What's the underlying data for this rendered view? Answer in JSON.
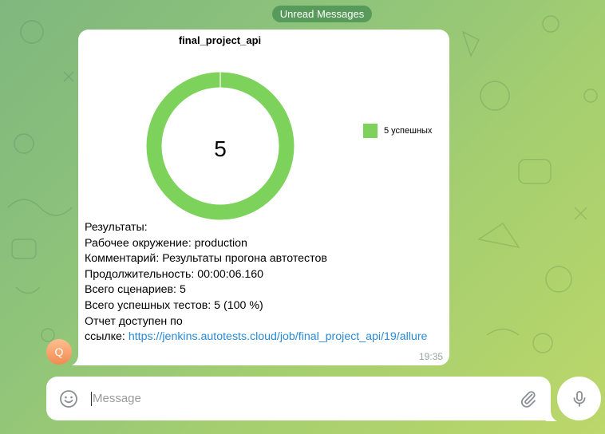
{
  "unread_label": "Unread Messages",
  "message": {
    "chart_data": {
      "type": "pie",
      "title": "final_project_api",
      "center_label": "5",
      "categories": [
        "5 успешных"
      ],
      "values": [
        5
      ],
      "colors": [
        "#7cd25a"
      ],
      "legend_position": "right"
    },
    "lines": [
      "Результаты:",
      "Рабочее окружение: production",
      "Комментарий: Результаты прогона автотестов",
      "Продолжительность: 00:00:06.160",
      "Всего сценариев: 5",
      "Всего успешных тестов: 5 (100 %)",
      "Отчет доступен по"
    ],
    "link_prefix": "ссылке: ",
    "link_text": "https://jenkins.autotests.cloud/job/final_project_api/19/allure",
    "time": "19:35"
  },
  "avatar_letter": "Q",
  "composer": {
    "placeholder": "Message",
    "emoji_icon": "smile-icon",
    "attach_icon": "paperclip-icon",
    "mic_icon": "microphone-icon"
  },
  "colors": {
    "accent_green": "#7cd25a",
    "link": "#2a8bd6",
    "pill": "#4a8c50"
  }
}
